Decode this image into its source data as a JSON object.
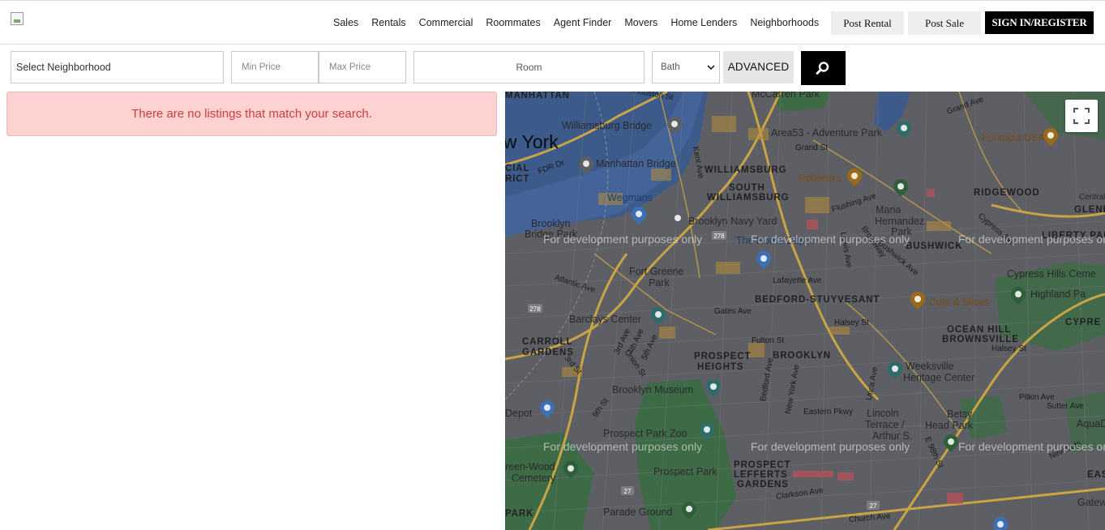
{
  "header": {
    "nav": [
      "Sales",
      "Rentals",
      "Commercial",
      "Roommates",
      "Agent Finder",
      "Movers",
      "Home Lenders",
      "Neighborhoods"
    ],
    "post_rental": "Post Rental",
    "post_sale": "Post Sale",
    "sign_in": "SIGN IN/REGISTER"
  },
  "search": {
    "neighborhood_placeholder": "Select Neighborhood",
    "min_price_placeholder": "Min Price",
    "max_price_placeholder": "Max Price",
    "room_placeholder": "Room",
    "bath_value": "Bath",
    "advanced": "ADVANCED"
  },
  "alert": {
    "message": "There are no listings that match your search."
  },
  "map": {
    "watermark": "For development purposes only",
    "city_label": "w York",
    "neighborhoods": [
      "WILLIAMSBURG",
      "SOUTH WILLIAMSBURG",
      "RIDGEWOOD",
      "BUSHWICK",
      "BEDFORD-STUYVESANT",
      "OCEAN HILL",
      "BROWNSVILLE",
      "CARROLL",
      "GARDENS",
      "PROSPECT",
      "HEIGHTS",
      "BROOKLYN",
      "PROSPECT",
      "LEFFERTS",
      "GARDENS",
      "GLENDA",
      "LIBERTY PARK",
      "CYPRE",
      "EAS",
      "MANHATTAN",
      "PARK",
      "CIAL",
      "RICT"
    ],
    "places": [
      "Williamsburg Bridge",
      "Manhattan Bridge",
      "McCarren Park",
      "Area53 - Adventure Park",
      "Funtopia USA",
      "Roberta's",
      "Wegmans",
      "Brooklyn Navy Yard",
      "Maria",
      "Hernandez",
      "Park",
      "Brooklyn",
      "Bridge Park",
      "The Home Depot",
      "Fort Greene",
      "Park",
      "Cuts & Slices",
      "Cypress Hills Ceme",
      "Highland Pa",
      "Barclays Center",
      "Weeksville",
      "Heritage Center",
      "Brooklyn Museum",
      "Lincoln",
      "Terrace /",
      "Arthur S.",
      "Betsy",
      "Head Park",
      "Depot",
      "Prospect Park Zoo",
      "reen-Wood",
      "Cemetery",
      "Prospect Park",
      "Parade Ground",
      "AquaDu",
      "Gateway",
      "Central"
    ],
    "streets": [
      "Grand St",
      "Flushing Ave",
      "Atlantic Ave",
      "Lafayette Ave",
      "Gates Ave",
      "Halsey St",
      "Fulton St",
      "Eastern Pkwy",
      "Clarkson Ave",
      "Church Ave",
      "FDR Dr",
      "Kent Ave",
      "3rd Ave",
      "4th Ave",
      "5th Ave",
      "9th St",
      "Union St",
      "Bedford Ave",
      "New York Ave",
      "Utica Ave",
      "Lewis Ave",
      "Bushwick Ave",
      "Broadway",
      "Pitkin Ave",
      "Sutter Ave",
      "New Lots",
      "Grand Ave",
      "E 98th St",
      "Cypress Ave",
      "Halsey St",
      "Houston St",
      "3rd St"
    ],
    "highway_shields": [
      "278",
      "278",
      "27",
      "27"
    ]
  }
}
